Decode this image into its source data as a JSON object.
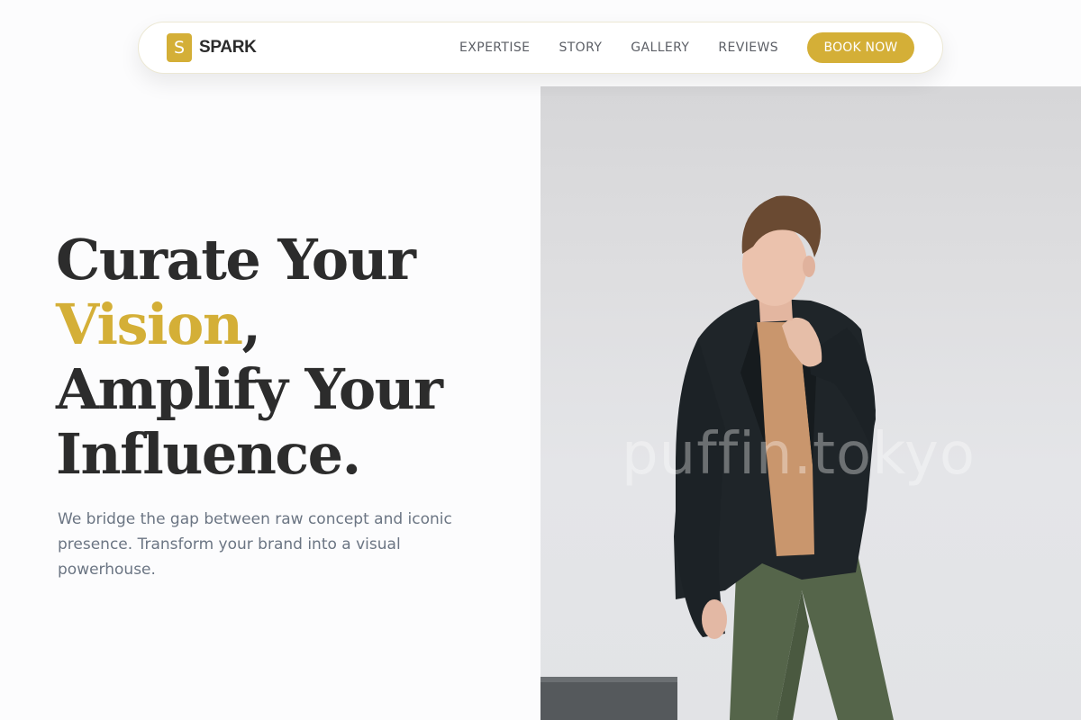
{
  "brand": {
    "mark": "S",
    "name": "SPARK",
    "accent_color": "#d4af37"
  },
  "nav": {
    "links": [
      "EXPERTISE",
      "STORY",
      "GALLERY",
      "REVIEWS"
    ],
    "cta_label": "BOOK NOW"
  },
  "hero": {
    "title_line1": "Curate Your",
    "title_accent": "Vision",
    "title_comma": ",",
    "title_line3": "Amplify Your",
    "title_line4": "Influence.",
    "subtitle": "We bridge the gap between raw concept and iconic presence. Transform your brand into a visual powerhouse.",
    "image_watermark": "puffin.tokyo"
  },
  "icons": {
    "brand_mark": "brand-logo-icon"
  }
}
